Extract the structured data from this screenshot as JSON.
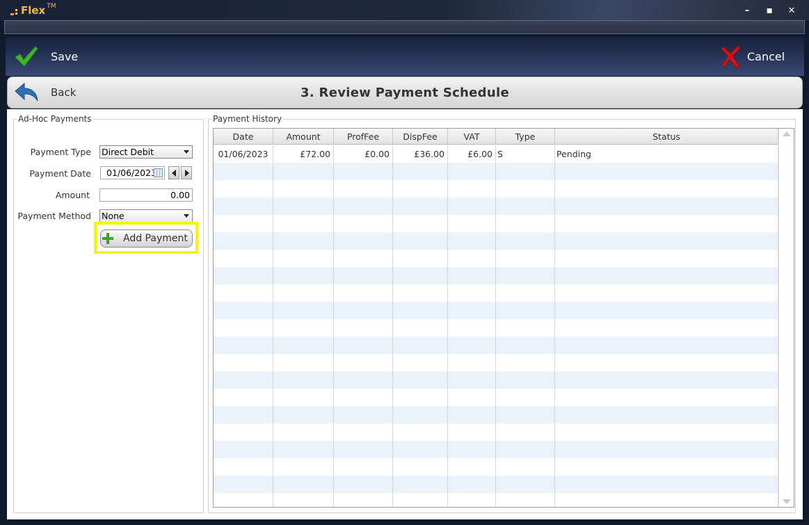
{
  "app": {
    "name": "Flex",
    "trademark": "TM"
  },
  "window_controls": {
    "minimize": "–",
    "maximize": "■",
    "close": "✕"
  },
  "toolbar": {
    "save_label": "Save",
    "cancel_label": "Cancel",
    "save_icon": "check-icon",
    "cancel_icon": "cross-icon",
    "save_color": "#3fb52a",
    "cancel_color": "#d2141a"
  },
  "header": {
    "back_label": "Back",
    "title": "3. Review Payment Schedule"
  },
  "adhoc": {
    "legend": "Ad-Hoc Payments",
    "payment_type_label": "Payment Type",
    "payment_type_value": "Direct Debit",
    "payment_date_label": "Payment Date",
    "payment_date_value": "01/06/2023",
    "amount_label": "Amount",
    "amount_value": "0.00",
    "payment_method_label": "Payment Method",
    "payment_method_value": "None",
    "add_button_label": "Add Payment",
    "highlight_color": "#f4f700"
  },
  "history": {
    "legend": "Payment History",
    "columns": [
      "Date",
      "Amount",
      "ProfFee",
      "DispFee",
      "VAT",
      "Type",
      "Status"
    ],
    "rows": [
      {
        "date": "01/06/2023",
        "amount": "£72.00",
        "proffee": "£0.00",
        "dispfee": "£36.00",
        "vat": "£6.00",
        "type": "S",
        "status": "Pending"
      }
    ]
  }
}
